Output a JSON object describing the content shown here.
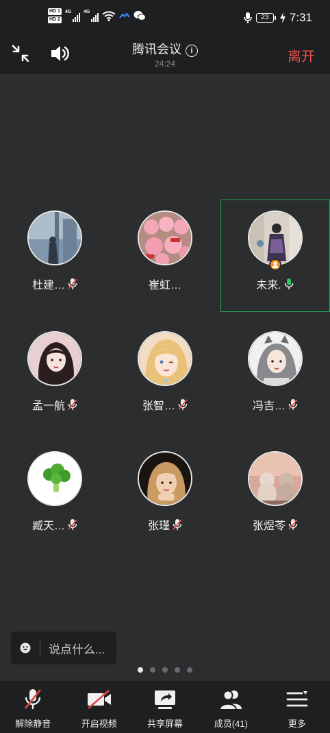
{
  "status_bar": {
    "sim1_label": "HD 1",
    "sim2_label": "HD 2",
    "network1": "4G",
    "network2": "4G",
    "battery_level": "23",
    "time": "7:31"
  },
  "header": {
    "title": "腾讯会议",
    "elapsed": "24:24",
    "leave_label": "离开"
  },
  "participants": [
    {
      "name": "杜建…",
      "mic": "muted"
    },
    {
      "name": "崔虹…",
      "mic": "none"
    },
    {
      "name": "未来.",
      "mic": "active",
      "host": true,
      "speaking": true
    },
    {
      "name": "孟一航",
      "mic": "muted"
    },
    {
      "name": "张智…",
      "mic": "muted"
    },
    {
      "name": "冯吉…",
      "mic": "muted"
    },
    {
      "name": "臧天…",
      "mic": "muted"
    },
    {
      "name": "张瑾",
      "mic": "muted"
    },
    {
      "name": "张煜苓",
      "mic": "muted"
    }
  ],
  "chat": {
    "placeholder": "说点什么..."
  },
  "pager": {
    "total": 5,
    "current": 1
  },
  "toolbar": {
    "unmute_label": "解除静音",
    "video_label": "开启视频",
    "share_label": "共享屏幕",
    "members_label": "成员(41)",
    "more_label": "更多"
  },
  "colors": {
    "background": "#2b2d2f",
    "bar": "#1e1f21",
    "leave": "#f0524a",
    "speaking_border": "#1fa85a",
    "mic_muted_slash": "#e0484a",
    "mic_active": "#2fc35f",
    "host_badge": "#ff8a1f"
  }
}
